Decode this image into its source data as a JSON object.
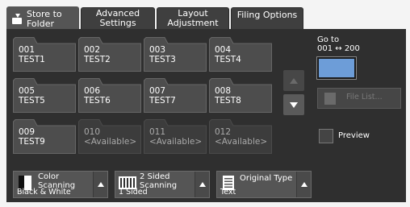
{
  "tabs": [
    {
      "line1": "Store to",
      "line2": "Folder"
    },
    {
      "line1": "Advanced",
      "line2": "Settings"
    },
    {
      "line1": "Layout",
      "line2": "Adjustment"
    },
    {
      "line1": "Filing Options",
      "line2": ""
    }
  ],
  "folders": [
    {
      "number": "001",
      "name": "TEST1"
    },
    {
      "number": "002",
      "name": "TEST2"
    },
    {
      "number": "003",
      "name": "TEST3"
    },
    {
      "number": "004",
      "name": "TEST4"
    },
    {
      "number": "005",
      "name": "TEST5"
    },
    {
      "number": "006",
      "name": "TEST6"
    },
    {
      "number": "007",
      "name": "TEST7"
    },
    {
      "number": "008",
      "name": "TEST8"
    },
    {
      "number": "009",
      "name": "TEST9"
    },
    {
      "number": "010",
      "name": "<Available>"
    },
    {
      "number": "011",
      "name": "<Available>"
    },
    {
      "number": "012",
      "name": "<Available>"
    }
  ],
  "goto": {
    "line1": "Go to",
    "line2": "001 ↔ 200"
  },
  "file_list_label": "File List...",
  "preview_label": "Preview",
  "options": {
    "color": {
      "line1": "Color",
      "line2": "Scanning",
      "value": "Black & White"
    },
    "sided": {
      "line1": "2 Sided",
      "line2": "Scanning",
      "value": "1 Sided"
    },
    "original": {
      "line1": "Original Type",
      "value": "Text"
    }
  },
  "colors": {
    "accent": "#6d9dd8",
    "panel": "#2f2f2f",
    "button": "#555555"
  }
}
